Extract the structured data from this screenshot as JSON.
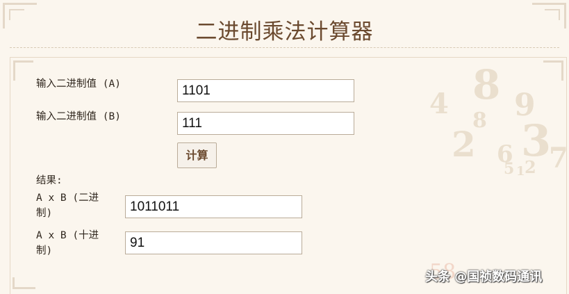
{
  "page": {
    "title": "二进制乘法计算器"
  },
  "form": {
    "input_a_label": "输入二进制值 (A)",
    "input_a_value": "1101",
    "input_b_label": "输入二进制值 (B)",
    "input_b_value": "111",
    "calculate_label": "计算",
    "results_label": "结果:",
    "binary_result_label_1": "A x B (二进",
    "binary_result_label_2": "制)",
    "binary_result_value": "1011011",
    "decimal_result_label_1": "A x B (十进",
    "decimal_result_label_2": "制)",
    "decimal_result_value": "91"
  },
  "watermark": {
    "text": "头条 @国祯数码通讯",
    "logo_text": "58"
  },
  "colors": {
    "background": "#fbf6ee",
    "title": "#6b4a2f",
    "border": "#b9ab98"
  }
}
